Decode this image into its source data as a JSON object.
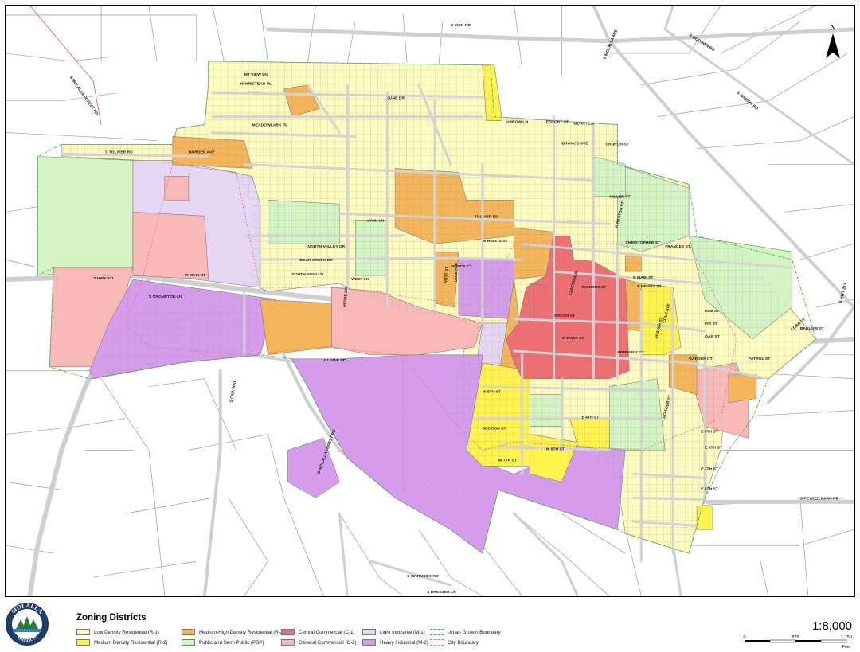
{
  "map": {
    "north_label": "N",
    "colors": {
      "r1": "#fffcbf",
      "r2": "#fff34d",
      "r3": "#f5b55a",
      "psp": "#d2f5c3",
      "c1": "#ef6f72",
      "c2": "#f8b9b7",
      "m1": "#e6d5f5",
      "m2": "#d49ceb",
      "road": "#d3d3d3",
      "parcel": "#8c8c8c"
    },
    "roads": [
      "S VICK RD",
      "S MCCOWN RD",
      "S MOLALLA AVE",
      "S WRIGHT RD",
      "S MOLALLA FOREST RD",
      "S TOLIVER RD",
      "TOLIVER RD",
      "W MAIN ST",
      "E MAIN ST",
      "S HWY 211",
      "S HWY 213",
      "S LOWE RD",
      "S FEYRER PARK RD",
      "S DRESSER LN",
      "S WARNOCK RD",
      "S ONA WAY",
      "S MOLALLA FOREST RD",
      "S ROSS ST",
      "E HEINTZ ST",
      "FRANCES ST",
      "CHRISTOPHER ST",
      "KIMBERLY CT",
      "GARDEN CT",
      "PATROL ST",
      "BARLOW ST",
      "MEADOWLARK PL",
      "BORDEN AVE",
      "NORTH VALLEY DR",
      "BEAR CREEK DR",
      "SOUTH VIEW LN",
      "WEST LN",
      "LYNN LN",
      "W HEINTZ ST",
      "PRINCE CT",
      "NOTT ST",
      "ROBBINS ST",
      "W ROSS ST",
      "E 5TH ST",
      "E 4TH ST",
      "E 6TH ST",
      "E 7TH ST",
      "E 8TH ST",
      "SECTION ST",
      "W 5TH ST",
      "W 6TH ST",
      "W 7TH ST",
      "S CROMPTON LN",
      "HESSE LN",
      "HOMESTEAD PL",
      "MT VIEW LN",
      "JUNE DR",
      "ESCORT ST",
      "CHURCH ST",
      "GLORY LN",
      "BRONCO AVE",
      "ARROW LN",
      "CENTER AVE",
      "COLE AVE",
      "SHAVER ST",
      "POWDER ST",
      "MILLER ST",
      "KIRKSTON ST",
      "OAK ST",
      "FIR ST",
      "ELM ST",
      "DIXIE AVE",
      "COBB ST"
    ]
  },
  "legend": {
    "title": "Zoning Districts",
    "items": [
      {
        "key": "r1",
        "label": "Low Density Residential (R-1)"
      },
      {
        "key": "r2",
        "label": "Medium Density Residential (R-2)"
      },
      {
        "key": "r3",
        "label": "Medium-High Density Residential (R-3)"
      },
      {
        "key": "psp",
        "label": "Public and Semi Public (PSP)"
      },
      {
        "key": "c1",
        "label": "Central Commercial (C-1)"
      },
      {
        "key": "c2",
        "label": "General Commercial (C-2)"
      },
      {
        "key": "m1",
        "label": "Light Industrial (M-1)"
      },
      {
        "key": "m2",
        "label": "Heavy Industrial (M-2)"
      },
      {
        "key": "ugb",
        "label": "Urban Growth Boundary"
      },
      {
        "key": "city",
        "label": "City Boundary"
      }
    ],
    "boundary_colors": {
      "ugb": "#49b14b",
      "city": "#e8767a"
    },
    "scale": {
      "ratio": "1:8,000",
      "ticks": [
        "0",
        "875",
        "1,750"
      ],
      "unit": "Feet"
    },
    "logo": {
      "top_text": "MOLALLA",
      "bottom_text": "OREGON"
    }
  }
}
